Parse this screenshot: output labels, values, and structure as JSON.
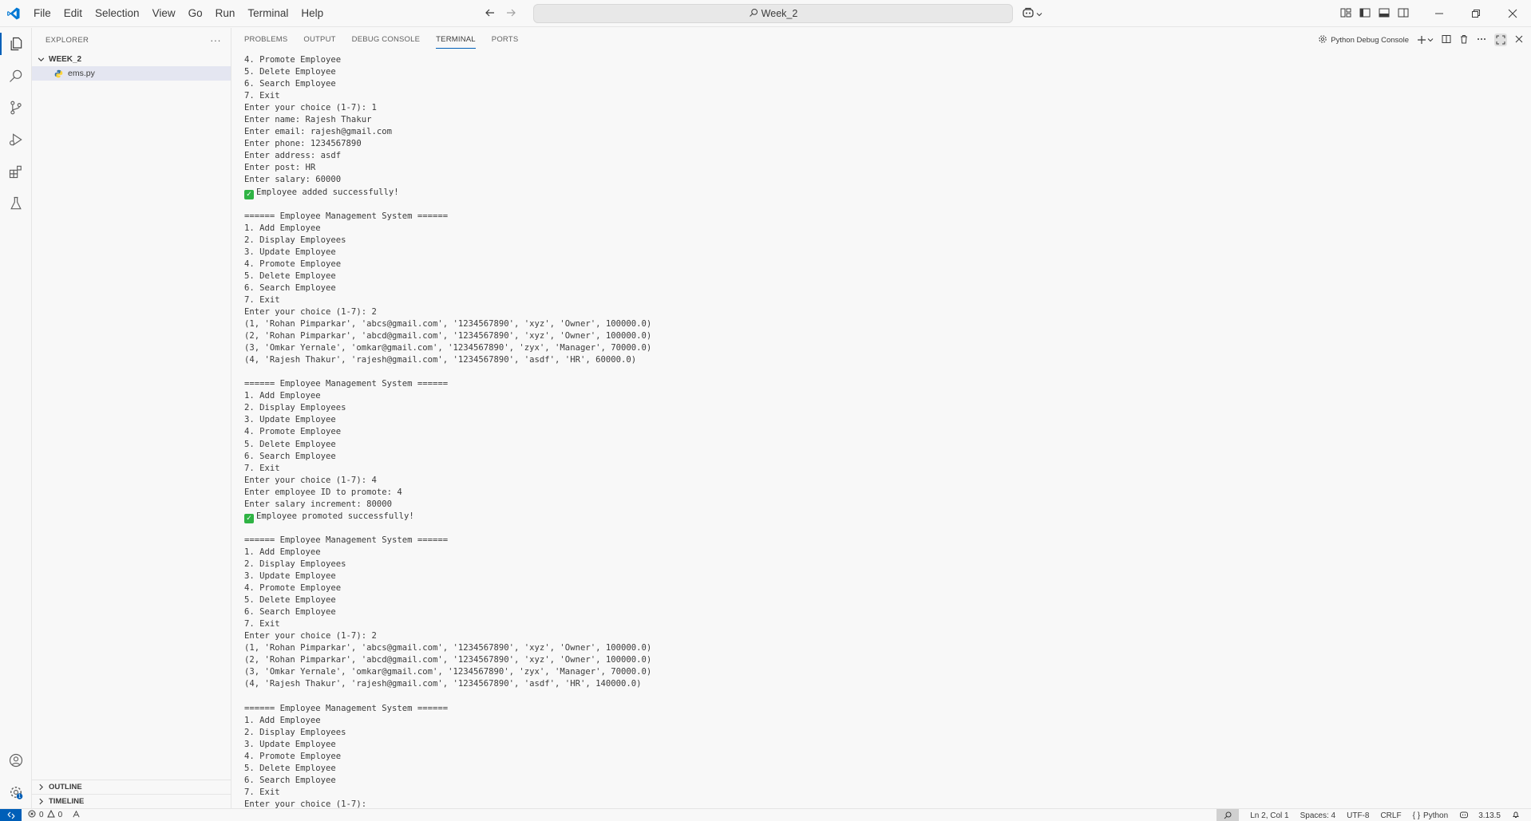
{
  "menu": [
    "File",
    "Edit",
    "Selection",
    "View",
    "Go",
    "Run",
    "Terminal",
    "Help"
  ],
  "command_center": {
    "label": "Week_2"
  },
  "sidebar": {
    "title": "EXPLORER",
    "more": "···",
    "folder": "WEEK_2",
    "file": "ems.py",
    "outline": "OUTLINE",
    "timeline": "TIMELINE"
  },
  "panel": {
    "tabs": [
      "PROBLEMS",
      "OUTPUT",
      "DEBUG CONSOLE",
      "TERMINAL",
      "PORTS"
    ],
    "active_tab": "TERMINAL",
    "session_name": "Python Debug Console"
  },
  "terminal": {
    "lines": [
      "4. Promote Employee",
      "5. Delete Employee",
      "6. Search Employee",
      "7. Exit",
      "Enter your choice (1-7): 1",
      "Enter name: Rajesh Thakur",
      "Enter email: rajesh@gmail.com",
      "Enter phone: 1234567890",
      "Enter address: asdf",
      "Enter post: HR",
      "Enter salary: 60000",
      "✅Employee added successfully!",
      "",
      "====== Employee Management System ======",
      "1. Add Employee",
      "2. Display Employees",
      "3. Update Employee",
      "4. Promote Employee",
      "5. Delete Employee",
      "6. Search Employee",
      "7. Exit",
      "Enter your choice (1-7): 2",
      "(1, 'Rohan Pimparkar', 'abcs@gmail.com', '1234567890', 'xyz', 'Owner', 100000.0)",
      "(2, 'Rohan Pimparkar', 'abcd@gmail.com', '1234567890', 'xyz', 'Owner', 100000.0)",
      "(3, 'Omkar Yernale', 'omkar@gmail.com', '1234567890', 'zyx', 'Manager', 70000.0)",
      "(4, 'Rajesh Thakur', 'rajesh@gmail.com', '1234567890', 'asdf', 'HR', 60000.0)",
      "",
      "====== Employee Management System ======",
      "1. Add Employee",
      "2. Display Employees",
      "3. Update Employee",
      "4. Promote Employee",
      "5. Delete Employee",
      "6. Search Employee",
      "7. Exit",
      "Enter your choice (1-7): 4",
      "Enter employee ID to promote: 4",
      "Enter salary increment: 80000",
      "✅Employee promoted successfully!",
      "",
      "====== Employee Management System ======",
      "1. Add Employee",
      "2. Display Employees",
      "3. Update Employee",
      "4. Promote Employee",
      "5. Delete Employee",
      "6. Search Employee",
      "7. Exit",
      "Enter your choice (1-7): 2",
      "(1, 'Rohan Pimparkar', 'abcs@gmail.com', '1234567890', 'xyz', 'Owner', 100000.0)",
      "(2, 'Rohan Pimparkar', 'abcd@gmail.com', '1234567890', 'xyz', 'Owner', 100000.0)",
      "(3, 'Omkar Yernale', 'omkar@gmail.com', '1234567890', 'zyx', 'Manager', 70000.0)",
      "(4, 'Rajesh Thakur', 'rajesh@gmail.com', '1234567890', 'asdf', 'HR', 140000.0)",
      "",
      "====== Employee Management System ======",
      "1. Add Employee",
      "2. Display Employees",
      "3. Update Employee",
      "4. Promote Employee",
      "5. Delete Employee",
      "6. Search Employee",
      "7. Exit",
      "Enter your choice (1-7): "
    ]
  },
  "statusbar": {
    "errors": "0",
    "warnings": "0",
    "position": "Ln 2, Col 1",
    "spaces": "Spaces: 4",
    "encoding": "UTF-8",
    "eol": "CRLF",
    "language": "Python",
    "python_version": "3.13.5"
  },
  "colors": {
    "accent": "#005fb8",
    "check_green": "#2fb344"
  }
}
